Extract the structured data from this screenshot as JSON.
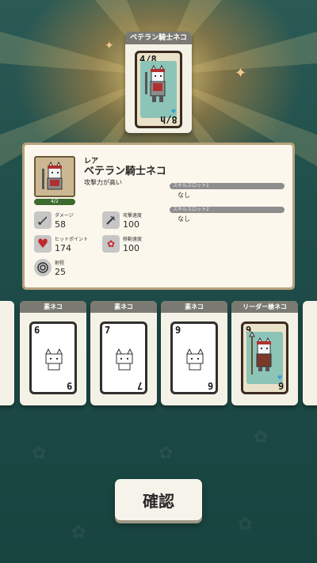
{
  "featured_card": {
    "name_plate": "ベテラン騎士ネコ",
    "top_number": "4/8",
    "bottom_number": "8/h"
  },
  "detail": {
    "rarity": "レア",
    "name": "ベテラン騎士ネコ",
    "description": "攻撃力が高い",
    "level_bar_text": "4/2",
    "skill_slots": [
      {
        "label": "スキルスロット1",
        "value": "なし"
      },
      {
        "label": "スキルスロット2",
        "value": "なし"
      }
    ],
    "stats": {
      "damage": {
        "label": "ダメージ",
        "value": "58"
      },
      "attack_speed": {
        "label": "攻撃速度",
        "value": "100"
      },
      "hit_points": {
        "label": "ヒットポイント",
        "value": "174"
      },
      "move_speed": {
        "label": "移動速度",
        "value": "100"
      },
      "range": {
        "label": "射程",
        "value": "25"
      }
    }
  },
  "card_row": [
    {
      "name": "素ネコ",
      "top": "6",
      "bottom": "9",
      "hero": false
    },
    {
      "name": "素ネコ",
      "top": "7",
      "bottom": "7",
      "hero": false
    },
    {
      "name": "素ネコ",
      "top": "9",
      "bottom": "6",
      "hero": false
    },
    {
      "name": "リーダー槍ネコ",
      "top": "9",
      "bottom": "6",
      "hero": true
    }
  ],
  "confirm_button": {
    "label": "確認"
  },
  "colors": {
    "background": "#1d4a47",
    "glow": "#f2c98a",
    "name_plate": "#7a7a72",
    "hp_heart": "#c0282d",
    "spade": "#3aa0d8"
  }
}
